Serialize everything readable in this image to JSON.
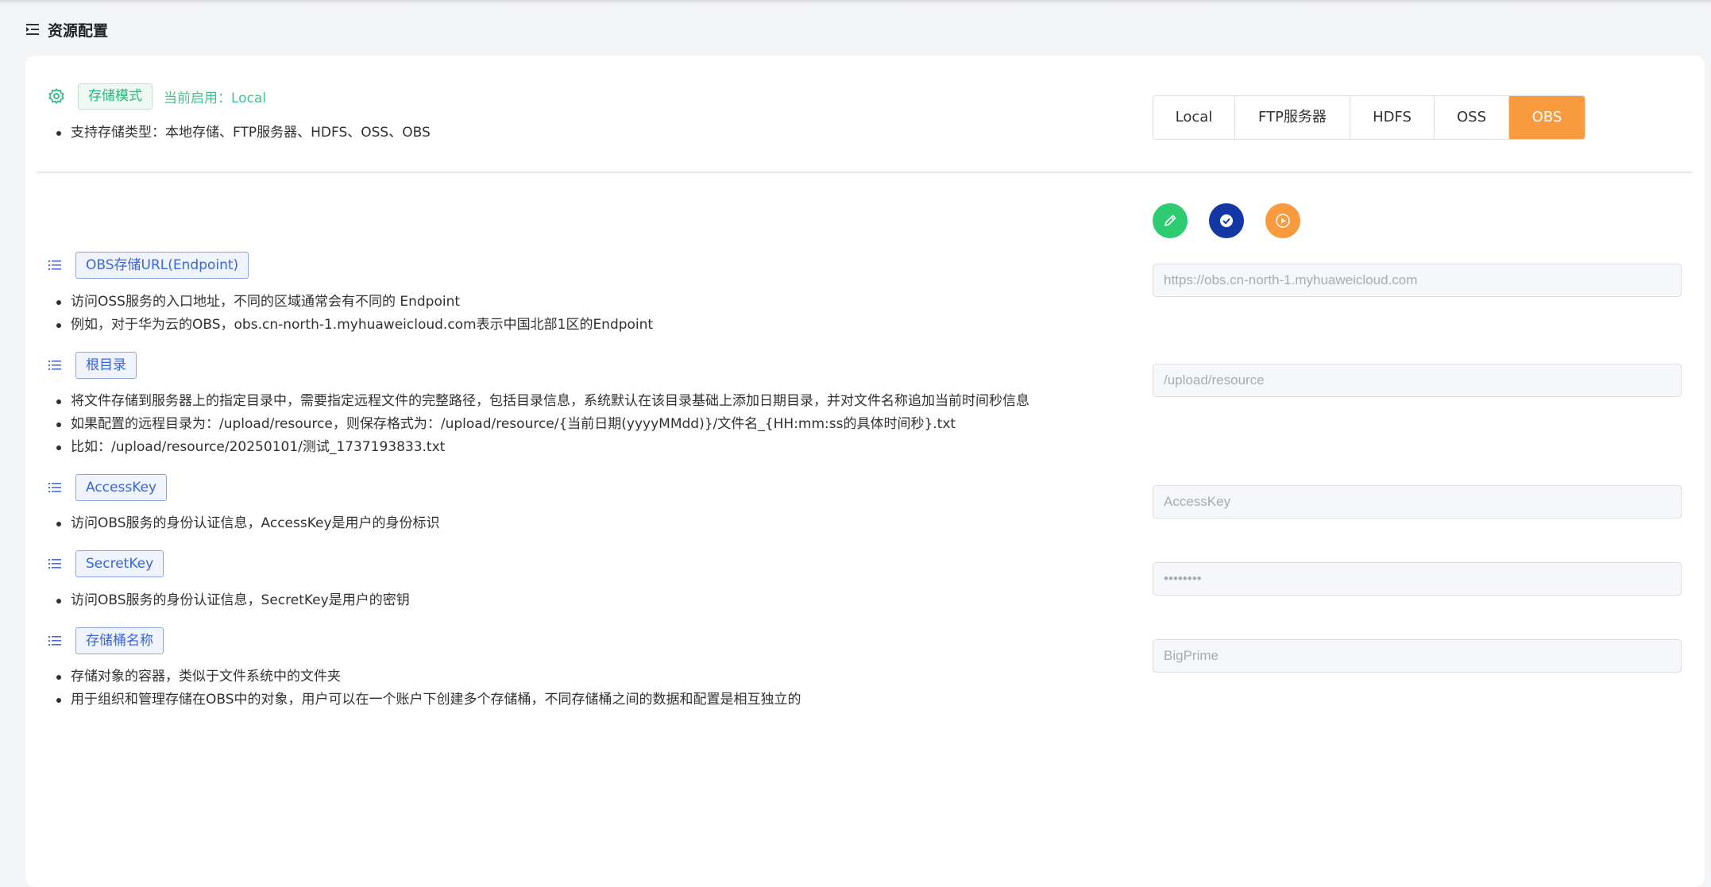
{
  "page": {
    "title": "资源配置",
    "title_icon": "list-indent-icon"
  },
  "storage_mode": {
    "tag": "存储模式",
    "current": "当前启用：Local",
    "bullets": [
      "支持存储类型：本地存储、FTP服务器、HDFS、OSS、OBS"
    ],
    "options": [
      {
        "label": "Local",
        "active": false
      },
      {
        "label": "FTP服务器",
        "active": false
      },
      {
        "label": "HDFS",
        "active": false
      },
      {
        "label": "OSS",
        "active": false
      },
      {
        "label": "OBS",
        "active": true
      }
    ]
  },
  "actions": {
    "edit_icon": "pencil-icon",
    "save_icon": "check-circle-icon",
    "test_icon": "play-circle-icon"
  },
  "fields": {
    "endpoint": {
      "label": "OBS存储URL(Endpoint)",
      "bullets": [
        "访问OSS服务的入口地址，不同的区域通常会有不同的 Endpoint",
        "例如，对于华为云的OBS，obs.cn-north-1.myhuaweicloud.com表示中国北部1区的Endpoint"
      ],
      "value": "https://obs.cn-north-1.myhuaweicloud.com"
    },
    "root_dir": {
      "label": "根目录",
      "bullets": [
        "将文件存储到服务器上的指定目录中，需要指定远程文件的完整路径，包括目录信息，系统默认在该目录基础上添加日期目录，并对文件名称追加当前时间秒信息",
        "如果配置的远程目录为：/upload/resource，则保存格式为：/upload/resource/{当前日期(yyyyMMdd)}/文件名_{HH:mm:ss的具体时间秒}.txt",
        "比如：/upload/resource/20250101/测试_1737193833.txt"
      ],
      "value": "/upload/resource"
    },
    "access_key": {
      "label": "AccessKey",
      "bullets": [
        "访问OBS服务的身份认证信息，AccessKey是用户的身份标识"
      ],
      "placeholder": "AccessKey"
    },
    "secret_key": {
      "label": "SecretKey",
      "bullets": [
        "访问OBS服务的身份认证信息，SecretKey是用户的密钥"
      ],
      "value": "••••••••"
    },
    "bucket": {
      "label": "存储桶名称",
      "bullets": [
        "存储对象的容器，类似于文件系统中的文件夹",
        "用于组织和管理存储在OBS中的对象，用户可以在一个账户下创建多个存储桶，不同存储桶之间的数据和配置是相互独立的"
      ],
      "value": "BigPrime"
    }
  },
  "colors": {
    "accent_orange": "#f99a3f",
    "tag_green": "#2bb77e",
    "tag_blue": "#3a66d6",
    "btn_green": "#2ecc71",
    "btn_blue": "#1338a3"
  }
}
